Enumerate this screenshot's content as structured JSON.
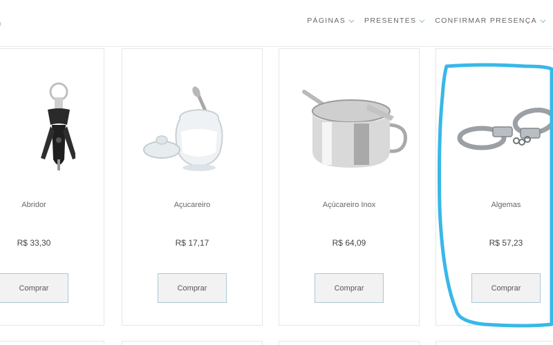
{
  "header": {
    "logo_fragment": ")",
    "nav": [
      {
        "label": "PÁGINAS",
        "icon": "chevron-down-icon"
      },
      {
        "label": "PRESENTES",
        "icon": "chevron-down-icon"
      },
      {
        "label": "CONFIRMAR PRESENÇA",
        "icon": "chevron-down-icon"
      }
    ]
  },
  "products": [
    {
      "name": "Abridor",
      "price": "R$ 33,30",
      "button": "Comprar",
      "icon": "corkscrew-icon"
    },
    {
      "name": "Açucareiro",
      "price": "R$ 17,17",
      "button": "Comprar",
      "icon": "glass-sugar-bowl-icon"
    },
    {
      "name": "Açúcareiro Inox",
      "price": "R$ 64,09",
      "button": "Comprar",
      "icon": "steel-sugar-bowl-icon"
    },
    {
      "name": "Algemas",
      "price": "R$ 57,23",
      "button": "Comprar",
      "icon": "handcuffs-icon"
    }
  ],
  "colors": {
    "highlight": "#38b8e8",
    "button_border": "#a9c7d6",
    "card_border": "#e6e6e6"
  }
}
